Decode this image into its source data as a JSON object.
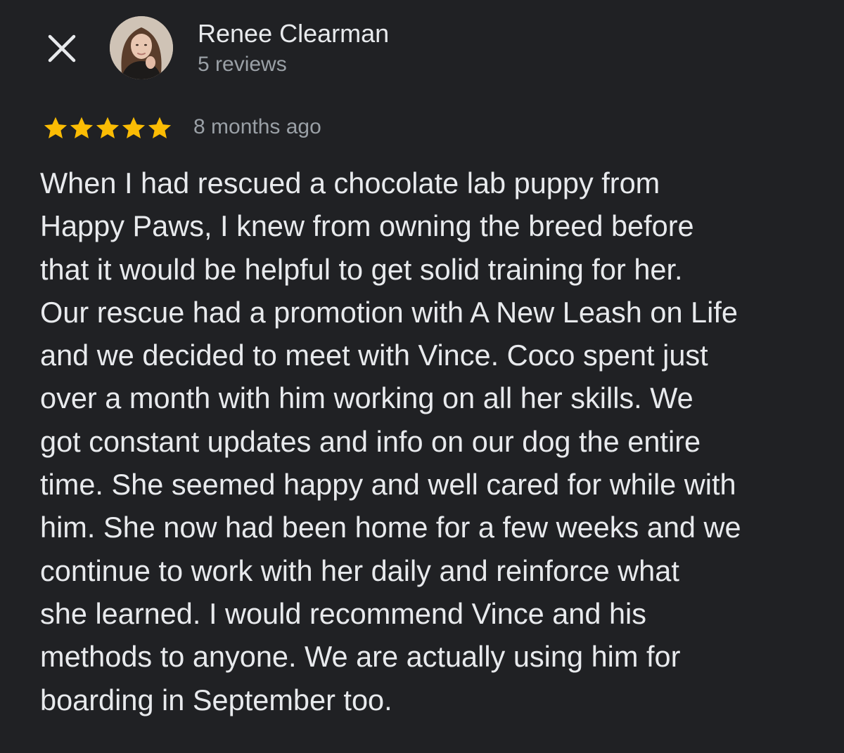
{
  "header": {
    "close_icon": "close-icon",
    "avatar_icon": "avatar-photo"
  },
  "reviewer": {
    "name": "Renee Clearman",
    "review_count": "5 reviews"
  },
  "rating": {
    "stars": 5,
    "max_stars": 5,
    "star_color": "#fbbc04",
    "time_ago": "8 months ago"
  },
  "review": {
    "lines": [
      "When I had rescued a chocolate lab puppy from",
      "Happy Paws, I knew from owning the breed before",
      "that it would be helpful to get solid training for her.",
      "Our rescue had a promotion with A New Leash on Life",
      "and we decided to meet with Vince. Coco spent just",
      "over a month with him working on all her skills. We",
      "got constant updates and info on our dog the entire",
      "time. She seemed happy and well cared for while with",
      "him. She now had been home for a few weeks and we",
      "continue to work with her daily and reinforce what",
      "she learned. I would recommend Vince and his",
      "methods to anyone. We are actually using him for",
      "boarding in September too."
    ]
  },
  "colors": {
    "background": "#202124",
    "primary_text": "#e8eaed",
    "secondary_text": "#9aa0a6"
  }
}
